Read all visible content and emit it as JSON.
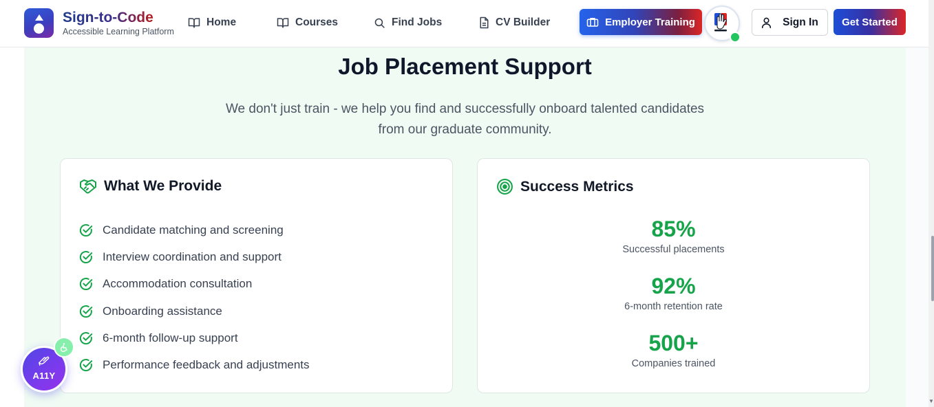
{
  "header": {
    "brand_name": "Sign-to-Code",
    "brand_tagline": "Accessible Learning Platform",
    "nav": [
      {
        "label": "Home",
        "icon": "book-open-icon"
      },
      {
        "label": "Courses",
        "icon": "book-open-icon"
      },
      {
        "label": "Find Jobs",
        "icon": "search-icon"
      },
      {
        "label": "CV Builder",
        "icon": "document-icon"
      }
    ],
    "employer_training": "Employer Training",
    "sign_in": "Sign In",
    "get_started": "Get Started"
  },
  "section": {
    "title": "Job Placement Support",
    "subtitle": "We don't just train - we help you find and successfully onboard talented candidates from our graduate community."
  },
  "provide": {
    "heading": "What We Provide",
    "items": [
      "Candidate matching and screening",
      "Interview coordination and support",
      "Accommodation consultation",
      "Onboarding assistance",
      "6-month follow-up support",
      "Performance feedback and adjustments"
    ]
  },
  "metrics": {
    "heading": "Success Metrics",
    "items": [
      {
        "value": "85%",
        "label": "Successful placements"
      },
      {
        "value": "92%",
        "label": "6-month retention rate"
      },
      {
        "value": "500+",
        "label": "Companies trained"
      }
    ]
  },
  "a11y": {
    "label": "A11Y"
  },
  "colors": {
    "accent_green": "#16a34a",
    "brand_blue": "#1d4ed8",
    "brand_red": "#dc2626",
    "section_bg": "#effbf3"
  }
}
